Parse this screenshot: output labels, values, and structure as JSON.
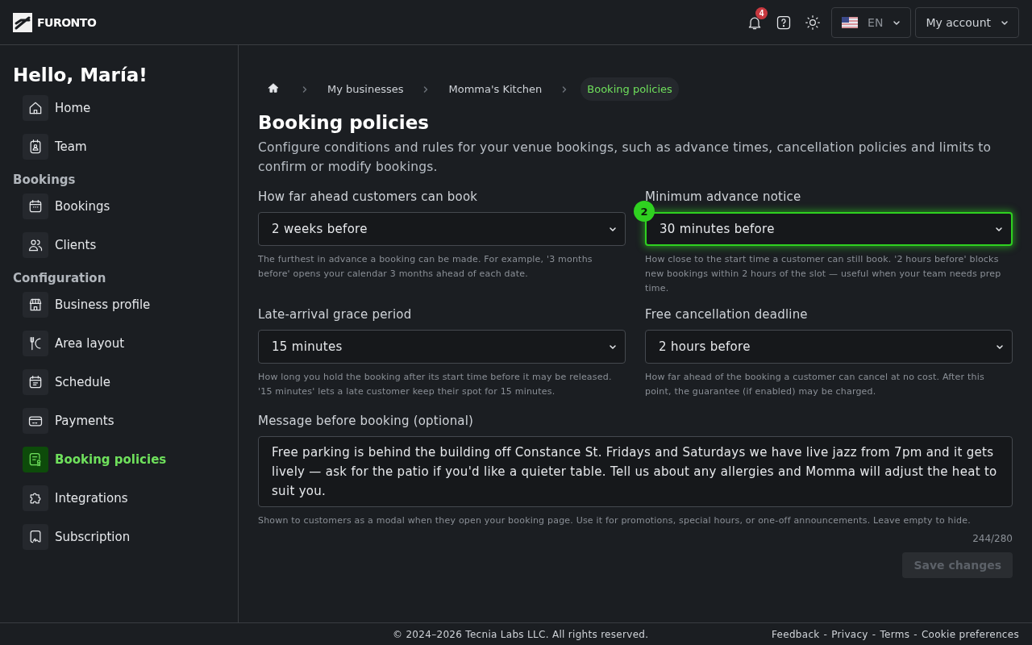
{
  "header": {
    "brand": "FURONTO",
    "notifications_count": "4",
    "language": "EN",
    "account": "My account"
  },
  "sidebar": {
    "greeting": "Hello, María!",
    "sections": [
      {
        "items": [
          {
            "label": "Home",
            "selected": false
          },
          {
            "label": "Team",
            "selected": false
          }
        ]
      },
      {
        "heading": "Bookings",
        "items": [
          {
            "label": "Bookings",
            "selected": false
          },
          {
            "label": "Clients",
            "selected": false
          }
        ]
      },
      {
        "heading": "Configuration",
        "items": [
          {
            "label": "Business profile",
            "selected": false
          },
          {
            "label": "Area layout",
            "selected": false
          },
          {
            "label": "Schedule",
            "selected": false
          },
          {
            "label": "Payments",
            "selected": false
          },
          {
            "label": "Booking policies",
            "selected": true
          },
          {
            "label": "Integrations",
            "selected": false
          },
          {
            "label": "Subscription",
            "selected": false
          }
        ]
      }
    ]
  },
  "breadcrumb": [
    {
      "label": "My businesses",
      "selected": false
    },
    {
      "label": "Momma's Kitchen",
      "selected": false
    },
    {
      "label": "Booking policies",
      "selected": true
    }
  ],
  "page": {
    "title": "Booking policies",
    "description": "Configure conditions and rules for your venue bookings, such as advance times, cancellation policies and limits to confirm or modify bookings."
  },
  "fields": [
    {
      "label": "How far ahead customers can book",
      "value": "2 weeks before",
      "help": "The furthest in advance a booking can be made. For example, '3 months before' opens your calendar 3 months ahead of each date.",
      "highlighted": false
    },
    {
      "label": "Minimum advance notice",
      "value": "30 minutes before",
      "help": "How close to the start time a customer can still book. '2 hours before' blocks new bookings within 2 hours of the slot — useful when your team needs prep time.",
      "highlighted": true,
      "badge": "2"
    },
    {
      "label": "Late-arrival grace period",
      "value": "15 minutes",
      "help": "How long you hold the booking after its start time before it may be released. '15 minutes' lets a late customer keep their spot for 15 minutes.",
      "highlighted": false
    },
    {
      "label": "Free cancellation deadline",
      "value": "2 hours before",
      "help": "How far ahead of the booking a customer can cancel at no cost. After this point, the guarantee (if enabled) may be charged.",
      "highlighted": false
    }
  ],
  "message": {
    "label": "Message before booking (optional)",
    "value": "Free parking is behind the building off Constance St. Fridays and Saturdays we have live jazz from 7pm and it gets lively — ask for the patio if you'd like a quieter table. Tell us about any allergies and Momma will adjust the heat to suit you.",
    "help": "Shown to customers as a modal when they open your booking page. Use it for promotions, special hours, or one-off announcements. Leave empty to hide.",
    "counter": "244/280"
  },
  "save_button": {
    "label": "Save changes",
    "disabled": true
  },
  "footer": {
    "copyright": "© 2024–2026 Tecnia Labs LLC. All rights reserved.",
    "links": [
      "Feedback",
      "Privacy",
      "Terms",
      "Cookie preferences"
    ],
    "separator": "-"
  }
}
